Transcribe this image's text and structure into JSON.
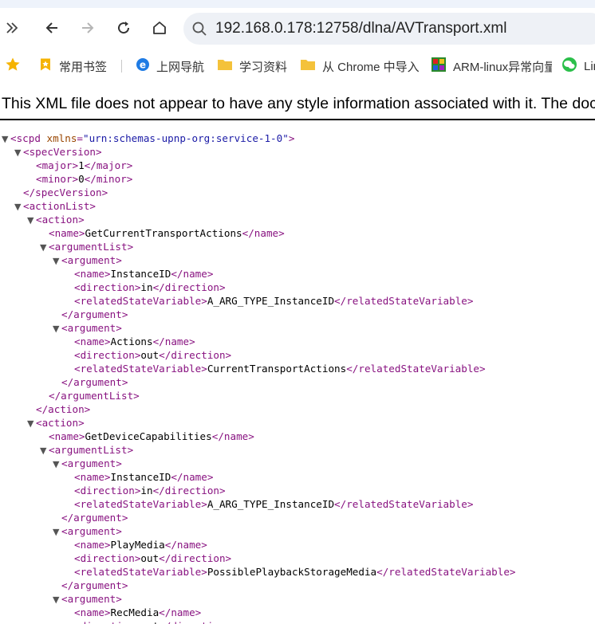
{
  "browser": {
    "url": "192.168.0.178:12758/dlna/AVTransport.xml",
    "bookmarks": [
      {
        "label": "常用书签",
        "icon": "bookmark-star-icon"
      },
      {
        "label": "上网导航",
        "icon": "ie-e-icon"
      },
      {
        "label": "学习资料",
        "icon": "folder-icon"
      },
      {
        "label": "从 Chrome 中导入",
        "icon": "folder-icon"
      },
      {
        "label": "ARM-linux异常向量",
        "icon": "colorful-app-icon"
      },
      {
        "label": "Lin",
        "icon": "wechat-icon"
      }
    ]
  },
  "notice": "This XML file does not appear to have any style information associated with it. The document tree is shown below.",
  "xml_lines": [
    {
      "indent": 0,
      "toggle": "▼",
      "text": "<scpd",
      "attr": " xmlns",
      "eq": "=",
      "val": "\"urn:schemas-upnp-org:service-1-0\"",
      "close": ">"
    },
    {
      "indent": 1,
      "toggle": "▼",
      "text": "<specVersion>"
    },
    {
      "indent": 2,
      "text": "<major>",
      "value": "1",
      "end": "</major>"
    },
    {
      "indent": 2,
      "text": "<minor>",
      "value": "0",
      "end": "</minor>"
    },
    {
      "indent": 1,
      "text": "</specVersion>"
    },
    {
      "indent": 1,
      "toggle": "▼",
      "text": "<actionList>"
    },
    {
      "indent": 2,
      "toggle": "▼",
      "text": "<action>"
    },
    {
      "indent": 3,
      "text": "<name>",
      "value": "GetCurrentTransportActions",
      "end": "</name>"
    },
    {
      "indent": 3,
      "toggle": "▼",
      "text": "<argumentList>"
    },
    {
      "indent": 4,
      "toggle": "▼",
      "text": "<argument>"
    },
    {
      "indent": 5,
      "text": "<name>",
      "value": "InstanceID",
      "end": "</name>"
    },
    {
      "indent": 5,
      "text": "<direction>",
      "value": "in",
      "end": "</direction>"
    },
    {
      "indent": 5,
      "text": "<relatedStateVariable>",
      "value": "A_ARG_TYPE_InstanceID",
      "end": "</relatedStateVariable>"
    },
    {
      "indent": 4,
      "text": "</argument>"
    },
    {
      "indent": 4,
      "toggle": "▼",
      "text": "<argument>"
    },
    {
      "indent": 5,
      "text": "<name>",
      "value": "Actions",
      "end": "</name>"
    },
    {
      "indent": 5,
      "text": "<direction>",
      "value": "out",
      "end": "</direction>"
    },
    {
      "indent": 5,
      "text": "<relatedStateVariable>",
      "value": "CurrentTransportActions",
      "end": "</relatedStateVariable>"
    },
    {
      "indent": 4,
      "text": "</argument>"
    },
    {
      "indent": 3,
      "text": "</argumentList>"
    },
    {
      "indent": 2,
      "text": "</action>"
    },
    {
      "indent": 2,
      "toggle": "▼",
      "text": "<action>"
    },
    {
      "indent": 3,
      "text": "<name>",
      "value": "GetDeviceCapabilities",
      "end": "</name>"
    },
    {
      "indent": 3,
      "toggle": "▼",
      "text": "<argumentList>"
    },
    {
      "indent": 4,
      "toggle": "▼",
      "text": "<argument>"
    },
    {
      "indent": 5,
      "text": "<name>",
      "value": "InstanceID",
      "end": "</name>"
    },
    {
      "indent": 5,
      "text": "<direction>",
      "value": "in",
      "end": "</direction>"
    },
    {
      "indent": 5,
      "text": "<relatedStateVariable>",
      "value": "A_ARG_TYPE_InstanceID",
      "end": "</relatedStateVariable>"
    },
    {
      "indent": 4,
      "text": "</argument>"
    },
    {
      "indent": 4,
      "toggle": "▼",
      "text": "<argument>"
    },
    {
      "indent": 5,
      "text": "<name>",
      "value": "PlayMedia",
      "end": "</name>"
    },
    {
      "indent": 5,
      "text": "<direction>",
      "value": "out",
      "end": "</direction>"
    },
    {
      "indent": 5,
      "text": "<relatedStateVariable>",
      "value": "PossiblePlaybackStorageMedia",
      "end": "</relatedStateVariable>"
    },
    {
      "indent": 4,
      "text": "</argument>"
    },
    {
      "indent": 4,
      "toggle": "▼",
      "text": "<argument>"
    },
    {
      "indent": 5,
      "text": "<name>",
      "value": "RecMedia",
      "end": "</name>"
    },
    {
      "indent": 5,
      "text": "<direction>",
      "value": "out",
      "end": "</direction>"
    }
  ]
}
